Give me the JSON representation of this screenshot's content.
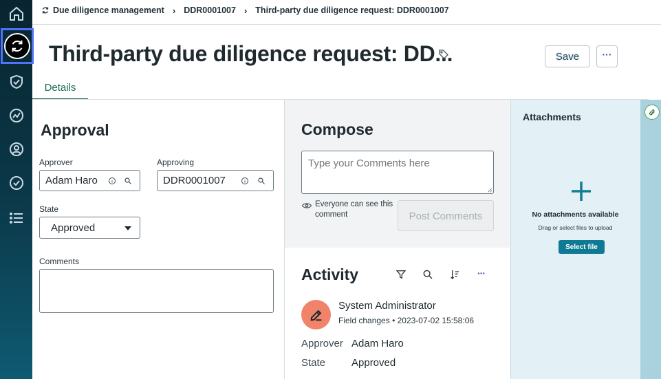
{
  "nav": {
    "items": [
      {
        "icon": "home-icon"
      },
      {
        "icon": "sync-icon",
        "active": true
      },
      {
        "icon": "shield-check-icon"
      },
      {
        "icon": "dashboard-icon"
      },
      {
        "icon": "globe-person-icon"
      },
      {
        "icon": "check-circle-icon"
      },
      {
        "icon": "list-icon"
      }
    ]
  },
  "breadcrumb": {
    "items": [
      "Due diligence management",
      "DDR0001007",
      "Third-party due diligence request: DDR0001007"
    ]
  },
  "header": {
    "title": "Third-party due diligence request: DD...",
    "save_label": "Save",
    "more_label": "···"
  },
  "tabs": [
    {
      "label": "Details",
      "active": true
    }
  ],
  "approval": {
    "heading": "Approval",
    "approver_label": "Approver",
    "approver_value": "Adam Haro",
    "approving_label": "Approving",
    "approving_value": "DDR0001007",
    "state_label": "State",
    "state_value": "Approved",
    "comments_label": "Comments",
    "comments_value": ""
  },
  "compose": {
    "heading": "Compose",
    "placeholder": "Type your Comments here",
    "visibility_note": "Everyone can see this comment",
    "post_label": "Post Comments"
  },
  "activity": {
    "heading": "Activity",
    "more_label": "···",
    "entries": [
      {
        "user": "System Administrator",
        "type": "Field changes",
        "bullet": "•",
        "timestamp": "2023-07-02 15:58:06",
        "changes": [
          {
            "field": "Approver",
            "value": "Adam Haro"
          },
          {
            "field": "State",
            "value": "Approved"
          }
        ]
      }
    ]
  },
  "attachments": {
    "heading": "Attachments",
    "empty_title": "No attachments available",
    "empty_hint": "Drag or select files to upload",
    "select_label": "Select file"
  },
  "colors": {
    "accent": "#1a6e52",
    "nav_highlight": "#4f72ff",
    "avatar": "#f2836b",
    "select_button": "#0f7a93"
  }
}
